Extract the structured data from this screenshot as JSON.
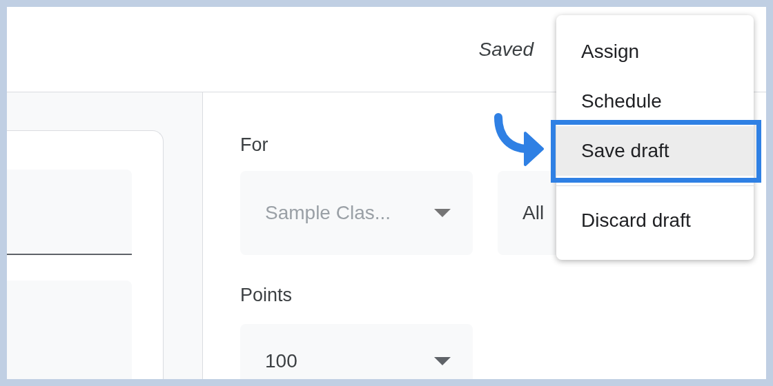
{
  "header": {
    "status": "Saved"
  },
  "assignment": {
    "for_label": "For",
    "class_select": {
      "placeholder": "Sample Clas..."
    },
    "students_select": {
      "value": "All"
    },
    "points_label": "Points",
    "points_select": {
      "value": "100"
    }
  },
  "menu": {
    "items": [
      {
        "label": "Assign",
        "selected": false,
        "divider_before": false
      },
      {
        "label": "Schedule",
        "selected": false,
        "divider_before": false
      },
      {
        "label": "Save draft",
        "selected": true,
        "divider_before": false
      },
      {
        "label": "Discard draft",
        "selected": false,
        "divider_before": true
      }
    ]
  }
}
